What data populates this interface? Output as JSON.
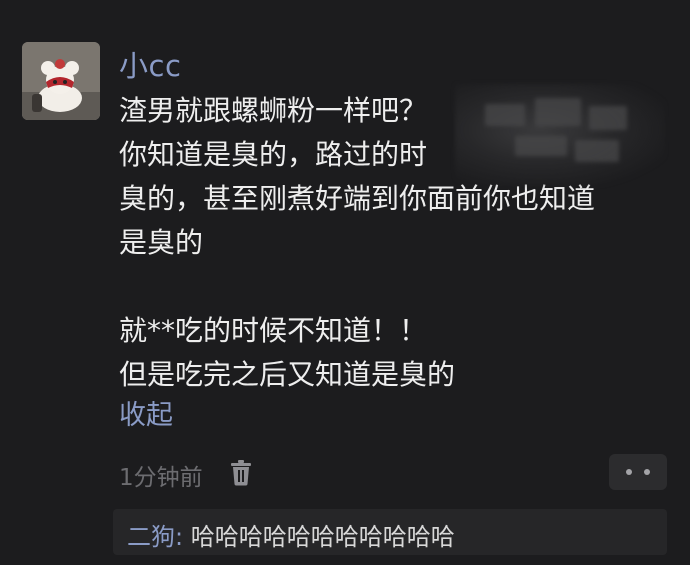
{
  "comment": {
    "username": "小cc",
    "lines": [
      "渣男就跟螺蛳粉一样吧？",
      "你知道是臭的，路过的时",
      "臭的，甚至刚煮好端到你面前你也知道",
      "是臭的",
      "",
      "就**吃的时候不知道！！",
      "但是吃完之后又知道是臭的"
    ],
    "collapse_label": "收起",
    "time": "1分钟前",
    "trash_icon": "trash-icon",
    "more_icon": "more-dots-icon"
  },
  "reply": {
    "name": "二狗",
    "colon": ":",
    "text": "哈哈哈哈哈哈哈哈哈哈哈"
  },
  "colors": {
    "background": "#1c1c1e",
    "accent_name": "#8a9bc6",
    "text": "#eeeeee",
    "muted": "#6c6c70",
    "reply_background": "#262628"
  }
}
